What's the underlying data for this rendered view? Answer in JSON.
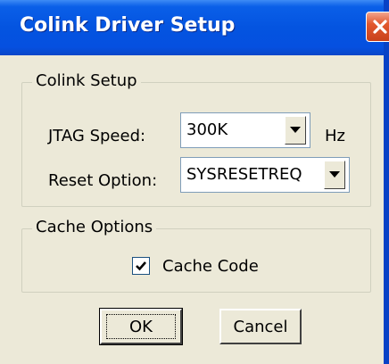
{
  "window": {
    "title": "Colink Driver Setup",
    "close_icon": "close-icon"
  },
  "colink_setup": {
    "group_label": "Colink Setup",
    "jtag_speed_label": "JTAG Speed:",
    "jtag_speed_value": "300K",
    "jtag_speed_unit": "Hz",
    "reset_option_label": "Reset Option:",
    "reset_option_value": "SYSRESETREQ"
  },
  "cache_options": {
    "group_label": "Cache Options",
    "cache_code_label": "Cache Code",
    "cache_code_checked": true
  },
  "buttons": {
    "ok_label": "OK",
    "cancel_label": "Cancel"
  },
  "colors": {
    "titlebar": "#0454e0",
    "close_button": "#e2582e",
    "dialog_background": "#ece9d8"
  }
}
